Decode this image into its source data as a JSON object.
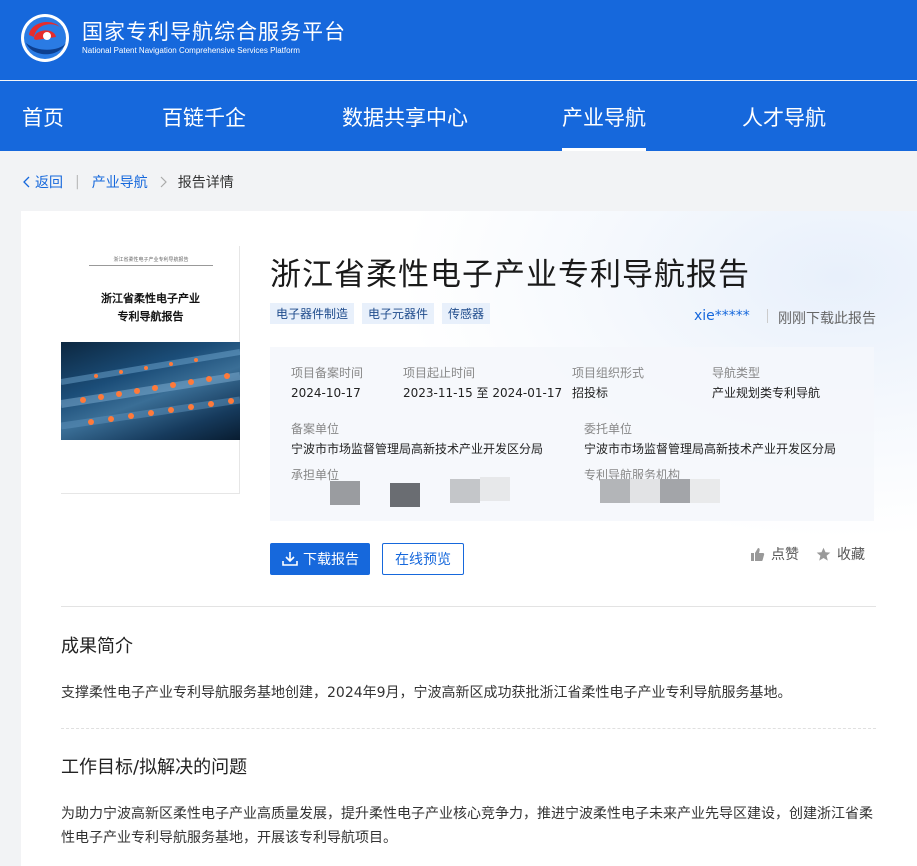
{
  "header": {
    "logo_cn": "国家专利导航综合服务平台",
    "logo_en": "National Patent Navigation Comprehensive Services Platform",
    "brand_color": "#1668dc"
  },
  "nav": {
    "items": [
      {
        "label": "首页",
        "active": false
      },
      {
        "label": "百链千企",
        "active": false
      },
      {
        "label": "数据共享中心",
        "active": false
      },
      {
        "label": "产业导航",
        "active": true
      },
      {
        "label": "人才导航",
        "active": false
      }
    ]
  },
  "breadcrumb": {
    "back": "返回",
    "parent": "产业导航",
    "current": "报告详情"
  },
  "cover": {
    "header_text": "浙江省柔性电子产业专利导航报告",
    "title_line1": "浙江省柔性电子产业",
    "title_line2": "专利导航报告"
  },
  "report": {
    "title": "浙江省柔性电子产业专利导航报告",
    "tags": [
      "电子器件制造",
      "电子元器件",
      "传感器"
    ],
    "user": "xie*****",
    "download_note": "刚刚下载此报告"
  },
  "info": {
    "record_time_label": "项目备案时间",
    "record_time": "2024-10-17",
    "period_label": "项目起止时间",
    "period": "2023-11-15 至 2024-01-17",
    "org_form_label": "项目组织形式",
    "org_form": "招投标",
    "nav_type_label": "导航类型",
    "nav_type": "产业规划类专利导航",
    "record_unit_label": "备案单位",
    "record_unit": "宁波市市场监督管理局高新技术产业开发区分局",
    "entrust_unit_label": "委托单位",
    "entrust_unit": "宁波市市场监督管理局高新技术产业开发区分局",
    "undertake_label": "承担单位",
    "service_org_label": "专利导航服务机构"
  },
  "actions": {
    "download": "下载报告",
    "preview": "在线预览",
    "like": "点赞",
    "favorite": "收藏"
  },
  "sections": [
    {
      "title": "成果简介",
      "text": "支撑柔性电子产业专利导航服务基地创建，2024年9月，宁波高新区成功获批浙江省柔性电子产业专利导航服务基地。"
    },
    {
      "title": "工作目标/拟解决的问题",
      "text": "为助力宁波高新区柔性电子产业高质量发展，提升柔性电子产业核心竞争力，推进宁波柔性电子未来产业先导区建设，创建浙江省柔性电子产业专利导航服务基地，开展该专利导航项目。"
    }
  ]
}
